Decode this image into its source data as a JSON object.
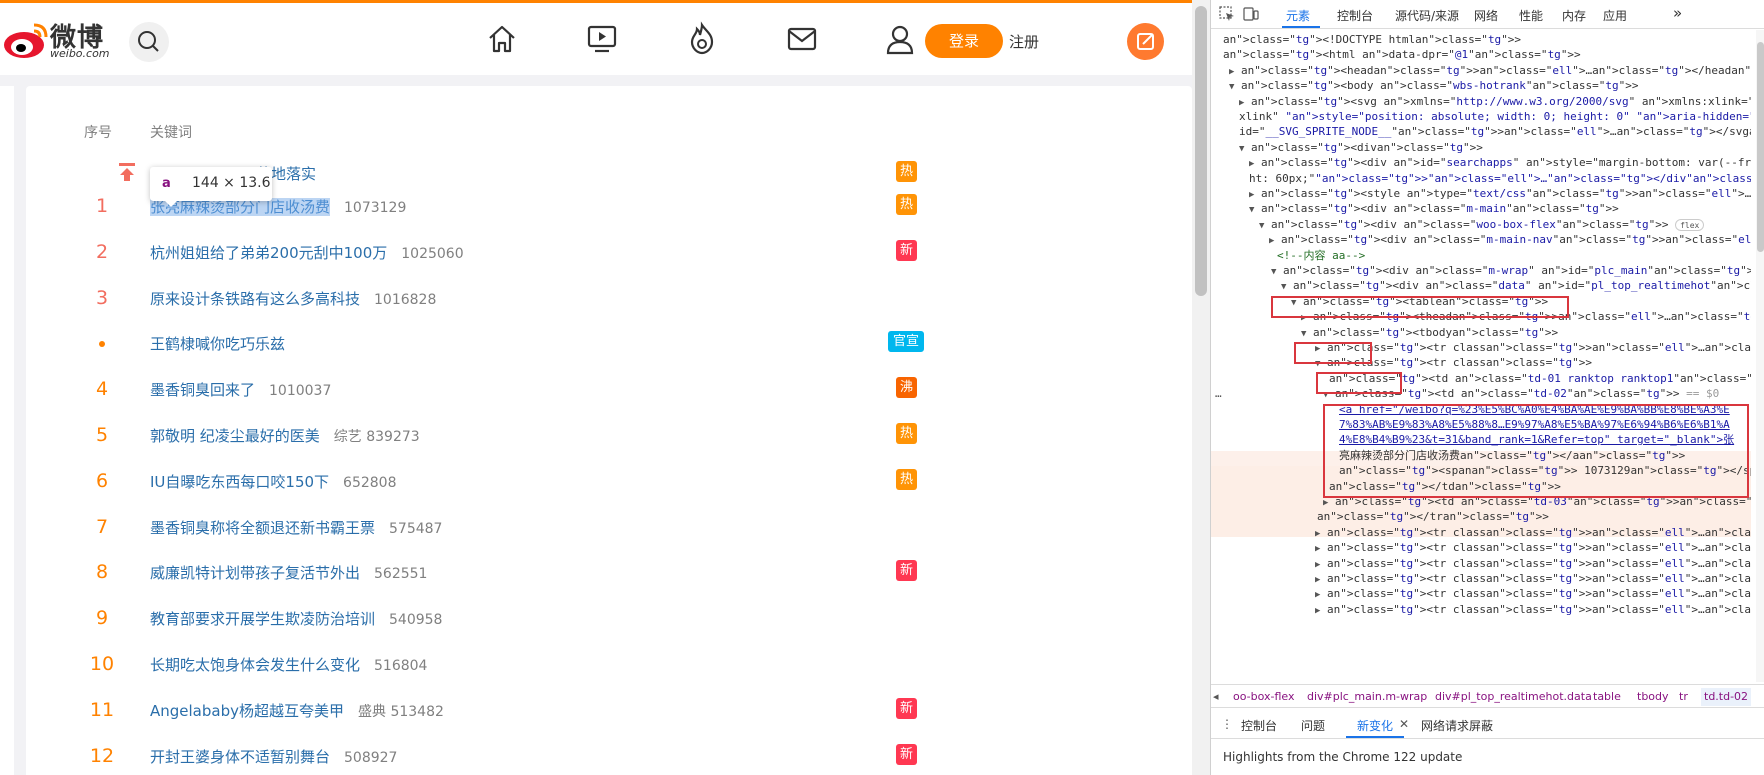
{
  "weibo": {
    "logo": {
      "text": "微博",
      "sub": "weibo.com"
    },
    "header": {
      "login": "登录",
      "register": "注册"
    },
    "table": {
      "col_rank": "序号",
      "col_keyword": "关键词",
      "pinned_fragment": "落地落实",
      "rows": [
        {
          "rank": "1",
          "kw_selected": "张亮麻辣烫部分门店收汤费",
          "kw": "",
          "num": "1073129",
          "badge": "热",
          "badge_type": "hot"
        },
        {
          "rank": "2",
          "kw": "杭州姐姐给了弟弟200元刮中100万",
          "num": "1025060",
          "badge": "新",
          "badge_type": "new"
        },
        {
          "rank": "3",
          "kw": "原来设计条铁路有这么多高科技",
          "num": "1016828",
          "badge": "",
          "badge_type": ""
        },
        {
          "rank": "•",
          "kw": "王鹤棣喊你吃巧乐兹",
          "num": "",
          "badge": "官宣",
          "badge_type": "gov"
        },
        {
          "rank": "4",
          "kw": "墨香铜臭回来了",
          "num": "1010037",
          "badge": "沸",
          "badge_type": "boil"
        },
        {
          "rank": "5",
          "kw": "郭敬明 纪凌尘最好的医美",
          "num": "综艺 839273",
          "badge": "热",
          "badge_type": "hot"
        },
        {
          "rank": "6",
          "kw": "IU自曝吃东西每口咬150下",
          "num": "652808",
          "badge": "热",
          "badge_type": "hot"
        },
        {
          "rank": "7",
          "kw": "墨香铜臭称将全额退还新书霸王票",
          "num": "575487",
          "badge": "",
          "badge_type": ""
        },
        {
          "rank": "8",
          "kw": "威廉凯特计划带孩子复活节外出",
          "num": "562551",
          "badge": "新",
          "badge_type": "new"
        },
        {
          "rank": "9",
          "kw": "教育部要求开展学生欺凌防治培训",
          "num": "540958",
          "badge": "",
          "badge_type": ""
        },
        {
          "rank": "10",
          "kw": "长期吃太饱身体会发生什么变化",
          "num": "516804",
          "badge": "",
          "badge_type": ""
        },
        {
          "rank": "11",
          "kw": "Angelababy杨超越互夸美甲",
          "num": "盛典 513482",
          "badge": "新",
          "badge_type": "new"
        },
        {
          "rank": "12",
          "kw": "开封王婆身体不适暂别舞台",
          "num": "508927",
          "badge": "新",
          "badge_type": "new"
        }
      ],
      "pinned_badge": "热"
    },
    "tooltip": {
      "tag": "a",
      "dims": "144 × 13.6"
    }
  },
  "devtools": {
    "tabs": [
      "元素",
      "控制台",
      "源代码/来源",
      "网络",
      "性能",
      "内存",
      "应用"
    ],
    "more": "»",
    "lines": [
      {
        "t": "<!DOCTYPE html>"
      },
      {
        "t": "<html data-dpr=\"@1\">"
      },
      {
        "t": "<head>…</head>"
      },
      {
        "t": "<body class=\"wbs-hotrank\">"
      },
      {
        "t": "<svg xmlns=\"http://www.w3.org/2000/svg\" xmlns:xlink=\"http://www.w3.org/1999/"
      },
      {
        "t": "xlink\" style=\"position: absolute; width: 0; height: 0\" aria-hidden=\"true\""
      },
      {
        "t": "id=\"__SVG_SPRITE_NODE__\">…</svg>"
      },
      {
        "t": "<div>"
      },
      {
        "t": "<div id=\"searchapps\" style=\"margin-bottom: var(--frame-mod-gap-space); heig"
      },
      {
        "t": "ht: 60px;\">…</div>"
      },
      {
        "t": "<style type=\"text/css\">…</style>"
      },
      {
        "t": "<div class=\"m-main\">"
      },
      {
        "t": "<div class=\"woo-box-flex\">"
      },
      {
        "t": "<div class=\"m-main-nav\">…</div>"
      },
      {
        "t": "<!--内容 aa-->"
      },
      {
        "t": "<div class=\"m-wrap\" id=\"plc_main\">"
      },
      {
        "t": "<div class=\"data\" id=\"pl_top_realtimehot\">"
      },
      {
        "t": "<table>"
      },
      {
        "t": "<thead>…</thead>"
      },
      {
        "t": "<tbody>"
      },
      {
        "t": "<tr class>…</tr>"
      },
      {
        "t": "<tr class>"
      },
      {
        "t": "<td class=\"td-01 ranktop ranktop1\">1</td>"
      },
      {
        "t": "<td class=\"td-02\"> == $0"
      },
      {
        "t": "<a href=\"/weibo?q=%23%E5%BC%A0%E4%BA%AE%E9%BA%BB%E8%BE%A3%E"
      },
      {
        "t": "7%83%AB%E9%83%A8%E5%88%8…E9%97%A8%E5%BA%97%E6%94%B6%E6%B1%A"
      },
      {
        "t": "4%E8%B4%B9%23&t=31&band_rank=1&Refer=top\" target=\"_blank\">张"
      },
      {
        "t": "亮麻辣烫部分门店收汤费</a>"
      },
      {
        "t": "<span> 1073129</span>"
      },
      {
        "t": "</td>"
      },
      {
        "t": "<td class=\"td-03\">…</td>"
      },
      {
        "t": "</tr>"
      },
      {
        "t": "<tr class>…</tr>"
      },
      {
        "t": "<tr class>…</tr>"
      },
      {
        "t": "<tr class>…</tr>"
      },
      {
        "t": "<tr class>…</tr>"
      },
      {
        "t": "<tr class>…</tr>"
      },
      {
        "t": "<tr class>…</tr>"
      }
    ],
    "flex_badge": "flex",
    "breadcrumb": [
      "oo-box-flex",
      "div#plc_main.m-wrap",
      "div#pl_top_realtimehot.data",
      "table",
      "tbody",
      "tr",
      "td.td-02"
    ],
    "drawer_tabs": [
      "控制台",
      "问题",
      "新变化",
      "网络请求屏蔽"
    ],
    "drawer_text": "Highlights from the Chrome 122 update"
  },
  "colors": {
    "accent": "#ff8200",
    "link": "#2a6eaa",
    "devtools_blue": "#1a73e8",
    "highlight_red": "#d9363e"
  }
}
